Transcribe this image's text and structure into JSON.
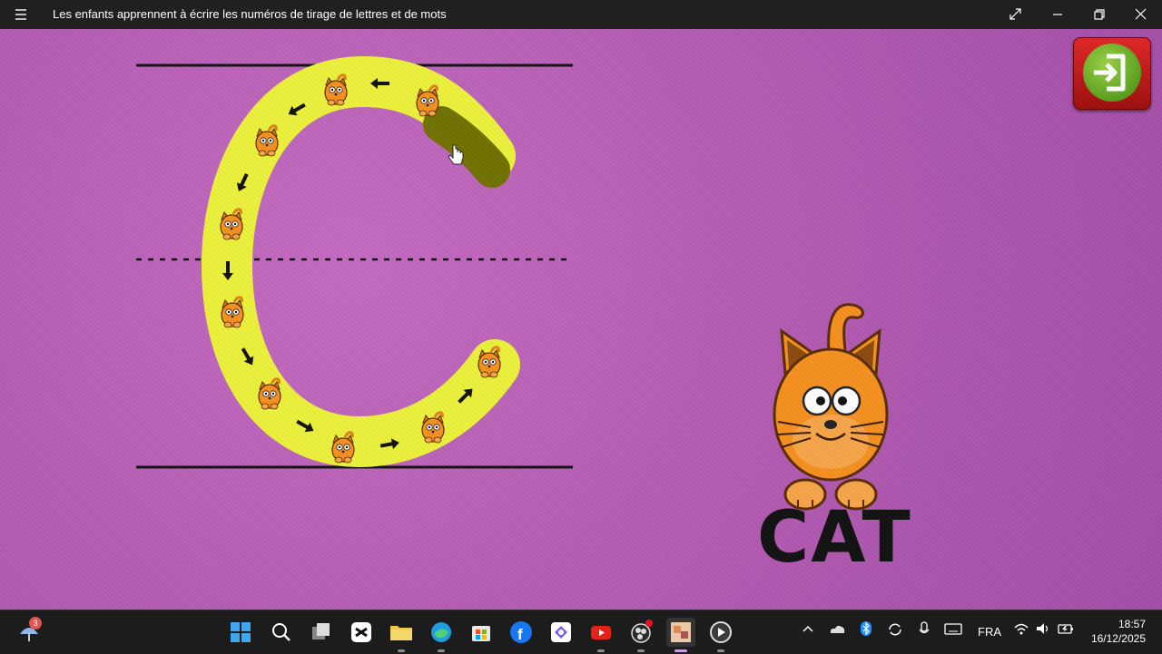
{
  "window": {
    "title": "Les enfants apprennent à écrire les numéros de tirage de lettres et de mots",
    "menu_icon": "hamburger-icon",
    "controls": [
      "fullscreen-icon",
      "minimize-icon",
      "restore-icon",
      "close-icon"
    ]
  },
  "lesson": {
    "letter_icon": "letter-c-tracing-path",
    "word": "CAT",
    "exit_icon": "exit-arrow-icon"
  },
  "taskbar": {
    "weather_badge": "3",
    "apps": [
      "windows-start-icon",
      "search-icon",
      "task-view-icon",
      "capcut-icon",
      "file-explorer-icon",
      "edge-icon",
      "store-icon",
      "facebook-icon",
      "copilot-icon",
      "youtube-icon",
      "obs-icon",
      "game-app-icon",
      "media-player-icon"
    ],
    "tray": {
      "language": "FRA"
    },
    "clock": {
      "time": "18:57",
      "date": "16/12/2025"
    }
  },
  "colors": {
    "background": "#b55cb4",
    "path_yellow": "#ecf23b",
    "traced": "#6f7200",
    "cat_orange": "#f5901e"
  }
}
